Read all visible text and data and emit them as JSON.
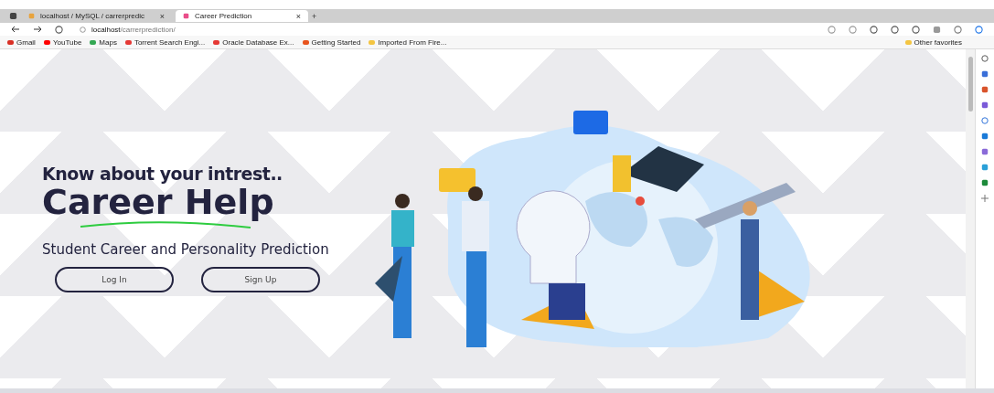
{
  "tabs": [
    {
      "title": "localhost / MySQL / carrerpredic",
      "selected": false,
      "close": "×"
    },
    {
      "title": "Career Prediction",
      "selected": true,
      "close": "×"
    }
  ],
  "new_tab": "+",
  "address_bar": {
    "host": "localhost",
    "path": "/carrerprediction/"
  },
  "bookmarks": [
    {
      "label": "Gmail",
      "color": "#d93025"
    },
    {
      "label": "YouTube",
      "color": "#ff0000"
    },
    {
      "label": "Maps",
      "color": "#34a853"
    },
    {
      "label": "Torrent Search Engi...",
      "color": "#e53935"
    },
    {
      "label": "Oracle Database Ex...",
      "color": "#e53935"
    },
    {
      "label": "Getting Started",
      "color": "#e8541e"
    },
    {
      "label": "Imported From Fire...",
      "color": "#f4c542"
    }
  ],
  "other_favorites": "Other favorites",
  "hero": {
    "tagline": "Know about your intrest..",
    "title": "Career Help",
    "subtitle": "Student Career and Personality Prediction",
    "buttons": [
      "Log In",
      "Sign Up"
    ]
  }
}
